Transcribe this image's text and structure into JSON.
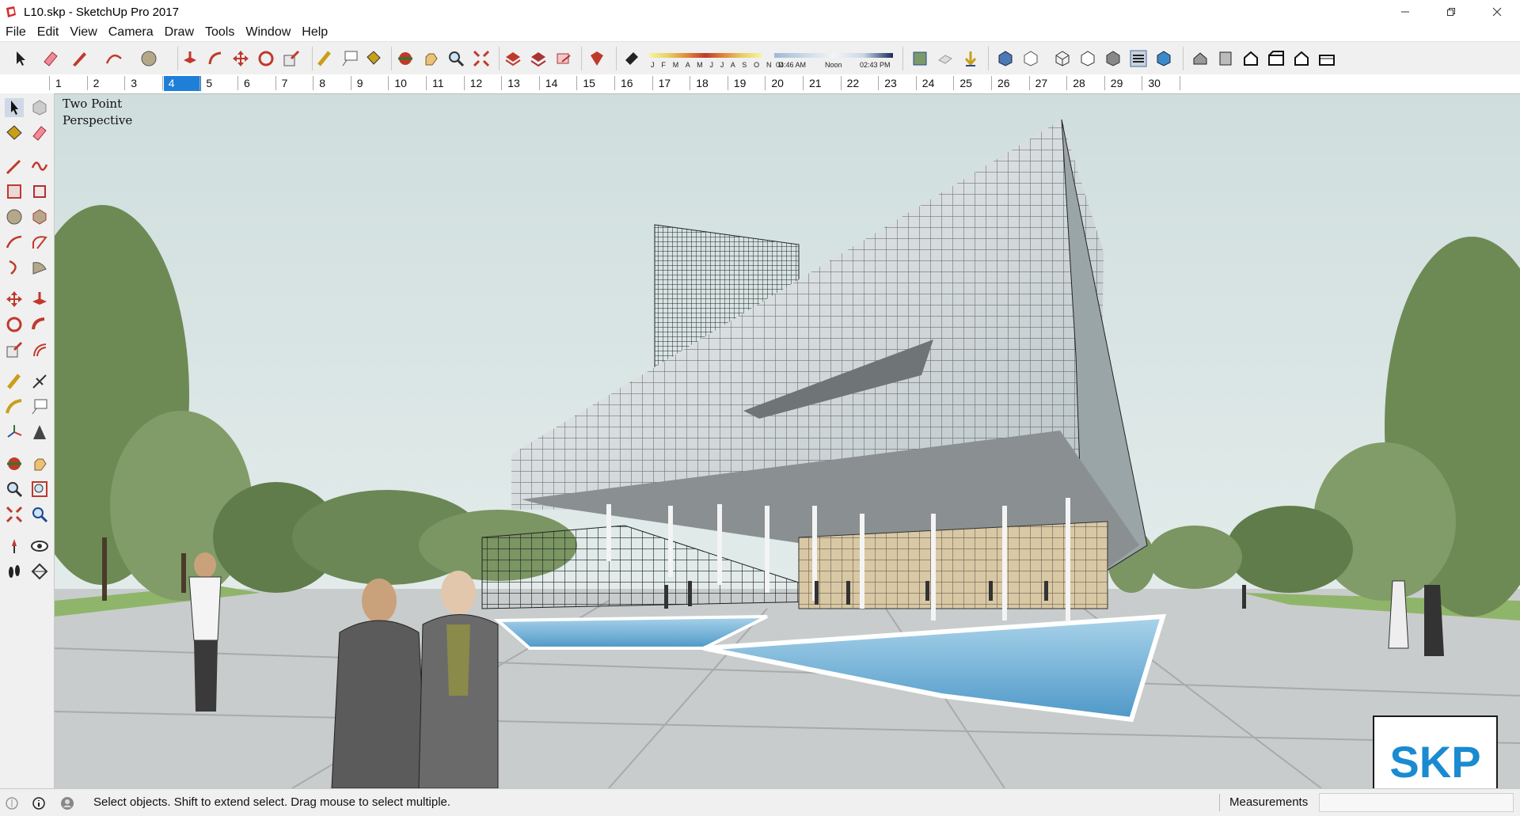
{
  "window": {
    "title": "L10.skp - SketchUp Pro 2017",
    "icon": "sketchup-app-icon"
  },
  "menu": [
    "File",
    "Edit",
    "View",
    "Camera",
    "Draw",
    "Tools",
    "Window",
    "Help"
  ],
  "shadows": {
    "months": "J F M A M J J A S O N D",
    "time_start": "04:46 AM",
    "time_mid": "Noon",
    "time_end": "02:43 PM"
  },
  "ruler": {
    "days": [
      "1",
      "2",
      "3",
      "4",
      "5",
      "6",
      "7",
      "8",
      "9",
      "10",
      "11",
      "12",
      "13",
      "14",
      "15",
      "16",
      "17",
      "18",
      "19",
      "20",
      "21",
      "22",
      "23",
      "24",
      "25",
      "26",
      "27",
      "28",
      "29",
      "30"
    ],
    "selected": "4"
  },
  "viewport": {
    "camera_mode_line1": "Two Point",
    "camera_mode_line2": "Perspective",
    "watermark": "SKP"
  },
  "status": {
    "message": "Select objects. Shift to extend select. Drag mouse to select multiple.",
    "measurements_label": "Measurements",
    "measurements_value": ""
  },
  "colors": {
    "sky": "#d6e3e2",
    "selected_day": "#1e7fd8",
    "logo_blue": "#1a8bd0"
  }
}
